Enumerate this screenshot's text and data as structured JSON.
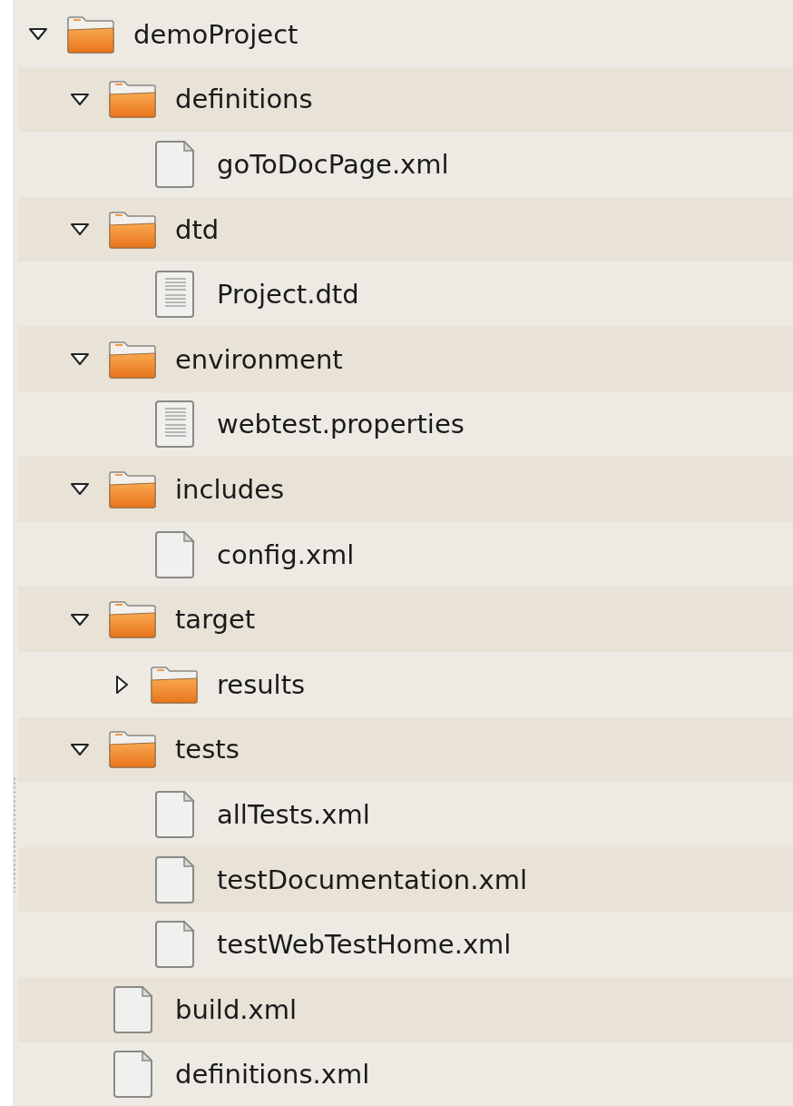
{
  "tree": [
    {
      "name": "demoProject",
      "kind": "folder",
      "expanded": true,
      "children": [
        {
          "name": "definitions",
          "kind": "folder",
          "expanded": true,
          "children": [
            {
              "name": "goToDocPage.xml",
              "kind": "file"
            }
          ]
        },
        {
          "name": "dtd",
          "kind": "folder",
          "expanded": true,
          "children": [
            {
              "name": "Project.dtd",
              "kind": "text-file"
            }
          ]
        },
        {
          "name": "environment",
          "kind": "folder",
          "expanded": true,
          "children": [
            {
              "name": "webtest.properties",
              "kind": "text-file"
            }
          ]
        },
        {
          "name": "includes",
          "kind": "folder",
          "expanded": true,
          "children": [
            {
              "name": "config.xml",
              "kind": "file"
            }
          ]
        },
        {
          "name": "target",
          "kind": "folder",
          "expanded": true,
          "children": [
            {
              "name": "results",
              "kind": "folder",
              "expanded": false
            }
          ]
        },
        {
          "name": "tests",
          "kind": "folder",
          "expanded": true,
          "children": [
            {
              "name": "allTests.xml",
              "kind": "file"
            },
            {
              "name": "testDocumentation.xml",
              "kind": "file"
            },
            {
              "name": "testWebTestHome.xml",
              "kind": "file"
            }
          ]
        },
        {
          "name": "build.xml",
          "kind": "file"
        },
        {
          "name": "definitions.xml",
          "kind": "file"
        }
      ]
    }
  ]
}
